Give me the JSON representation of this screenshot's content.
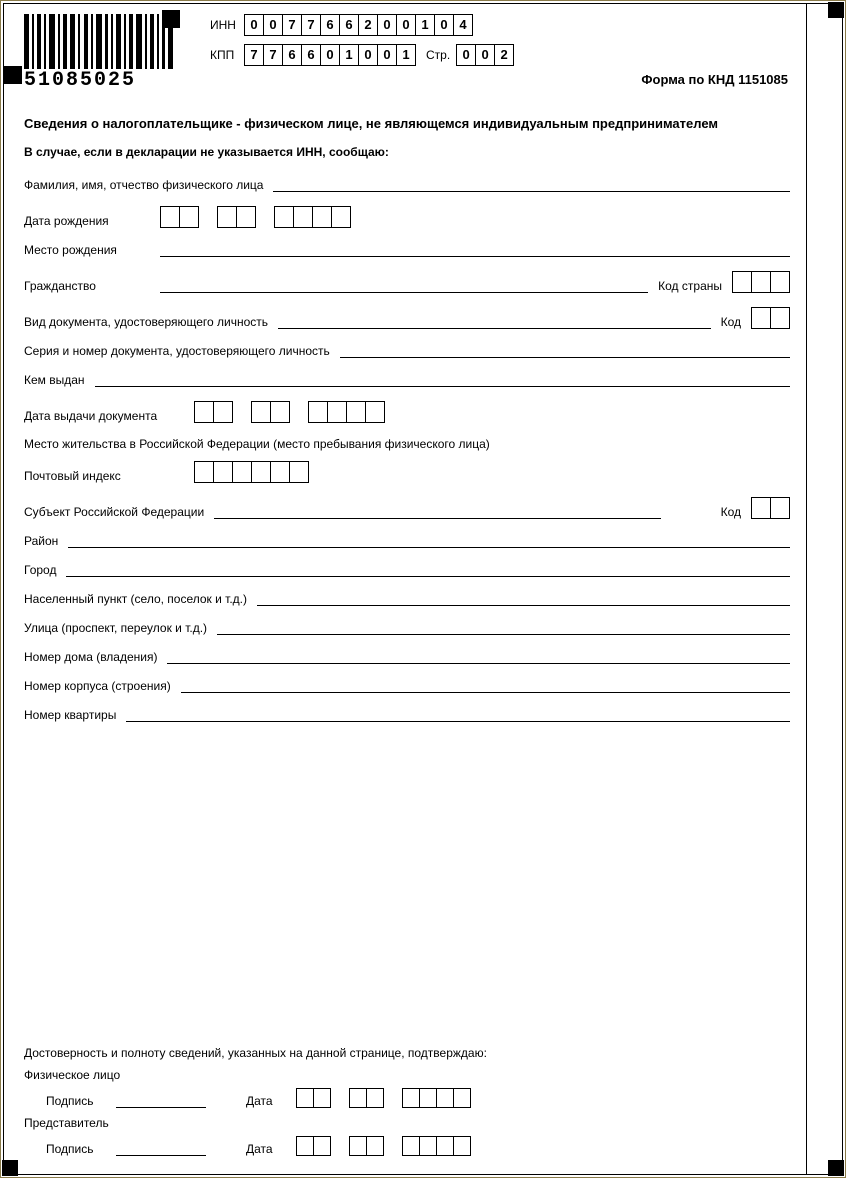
{
  "barcode_text": "51085025",
  "inn_label": "ИНН",
  "inn": [
    "0",
    "0",
    "7",
    "7",
    "6",
    "6",
    "2",
    "0",
    "0",
    "1",
    "0",
    "4"
  ],
  "kpp_label": "КПП",
  "kpp": [
    "7",
    "7",
    "6",
    "6",
    "0",
    "1",
    "0",
    "0",
    "1"
  ],
  "page_label": "Стр.",
  "page": [
    "0",
    "0",
    "2"
  ],
  "knd": "Форма по КНД 1151085",
  "title": "Сведения о налогоплательщике - физическом лице, не являющемся индивидуальным предпринимателем",
  "subtitle": "В случае, если в декларации не указывается ИНН, сообщаю:",
  "labels": {
    "fio": "Фамилия, имя, отчество физического лица",
    "dob": "Дата рождения",
    "pob": "Место рождения",
    "citizenship": "Гражданство",
    "country_code": "Код страны",
    "doc_type": "Вид документа, удостоверяющего личность",
    "code": "Код",
    "doc_serial": "Серия и номер документа, удостоверяющего личность",
    "issued_by": "Кем выдан",
    "doc_date": "Дата выдачи документа",
    "residence": "Место жительства в Российской Федерации (место пребывания физического лица)",
    "zip": "Почтовый индекс",
    "subject": "Субъект Российской Федерации",
    "district": "Район",
    "city": "Город",
    "settlement": "Населенный пункт (село, поселок и т.д.)",
    "street": "Улица (проспект, переулок и т.д.)",
    "house": "Номер дома (владения)",
    "building": "Номер корпуса (строения)",
    "flat": "Номер квартиры"
  },
  "footer": {
    "confirm": "Достоверность и полноту сведений, указанных на данной странице, подтверждаю:",
    "individual": "Физическое лицо",
    "representative": "Представитель",
    "sign": "Подпись",
    "date": "Дата"
  }
}
